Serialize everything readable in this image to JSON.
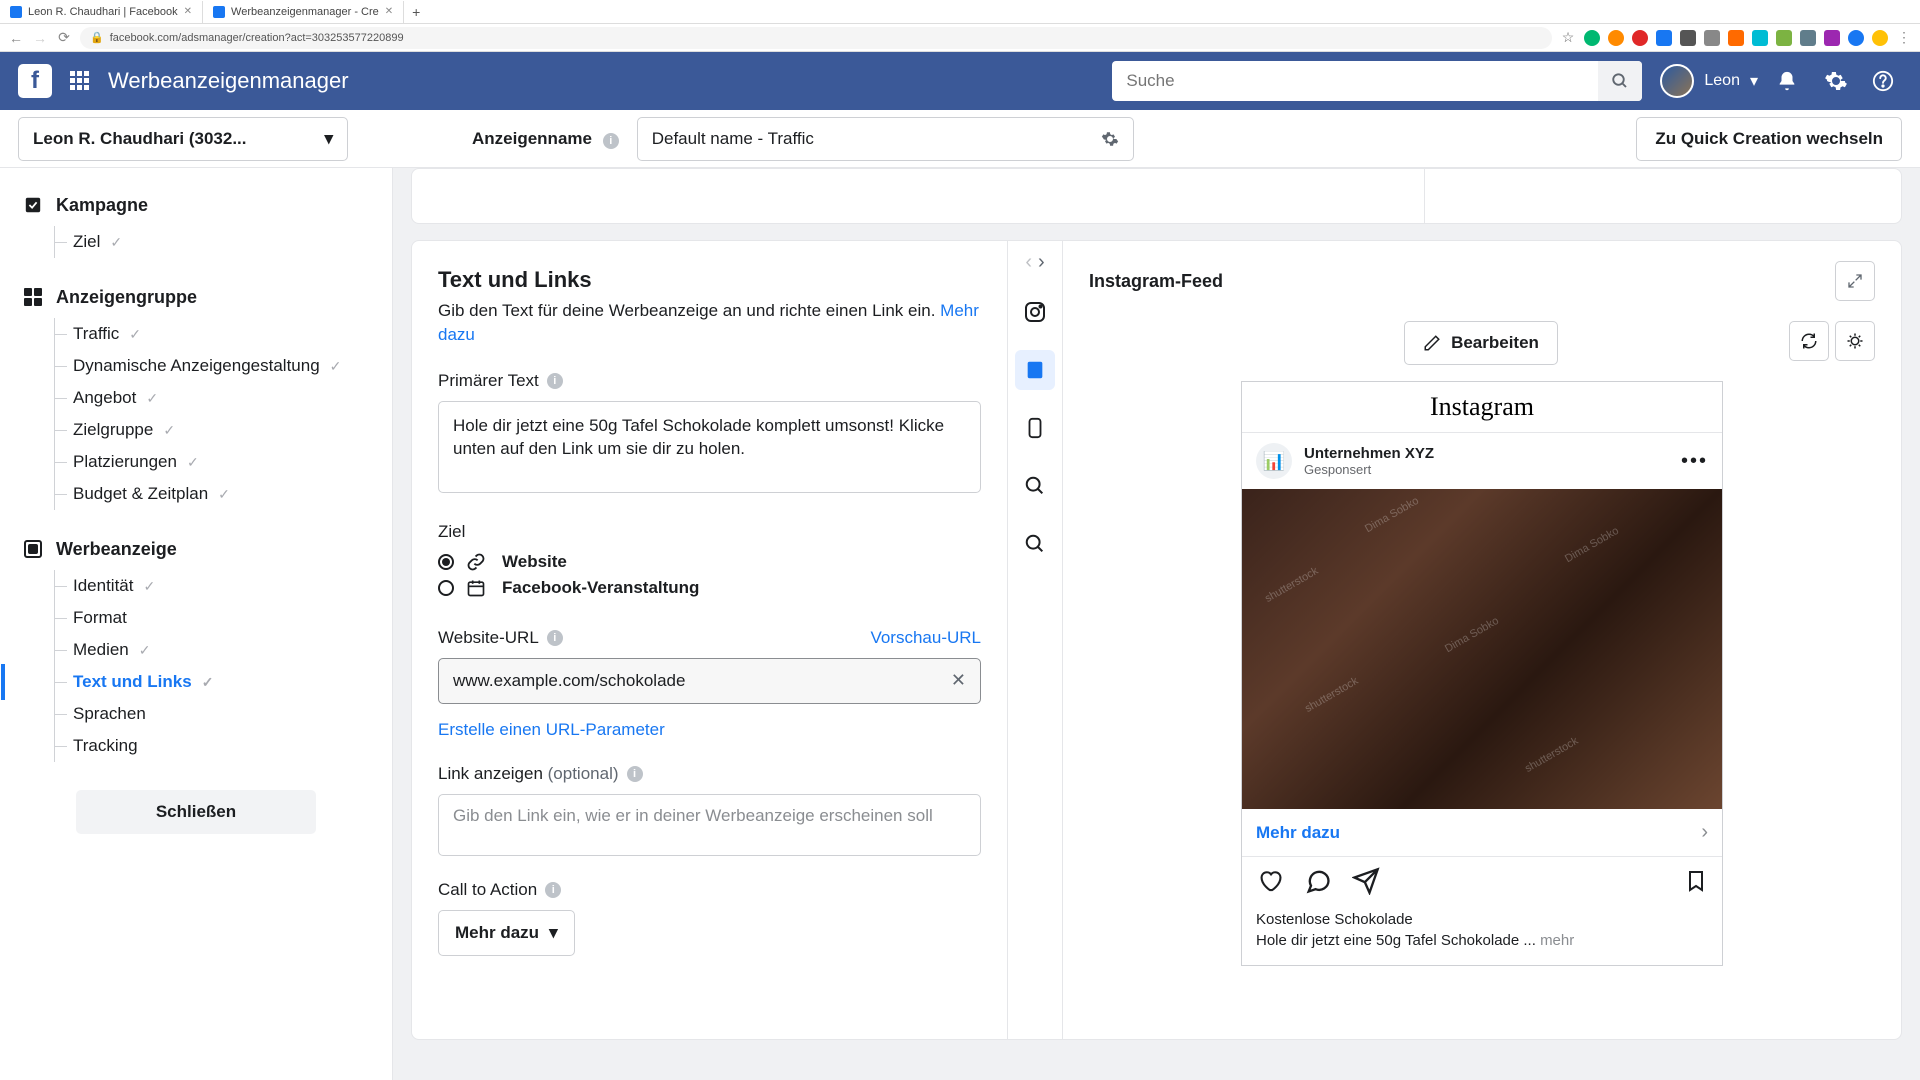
{
  "browser": {
    "tabs": [
      {
        "title": "Leon R. Chaudhari | Facebook",
        "icon_color": "#1877f2"
      },
      {
        "title": "Werbeanzeigenmanager - Cre",
        "icon_color": "#1877f2"
      }
    ],
    "url": "facebook.com/adsmanager/creation?act=303253577220899",
    "ext_colors": [
      "#00b871",
      "#ff8a00",
      "#e02828",
      "#1877f2",
      "#555",
      "#555",
      "#ff6a00",
      "#00bcd4",
      "#4caf50",
      "#607d8b",
      "#9c27b0",
      "#1877f2",
      "#ffc107"
    ]
  },
  "header": {
    "app_title": "Werbeanzeigenmanager",
    "search_placeholder": "Suche",
    "user_name": "Leon"
  },
  "secondbar": {
    "account": "Leon R. Chaudhari (3032...",
    "ad_name_label": "Anzeigenname",
    "ad_name_value": "Default name - Traffic",
    "quick_creation": "Zu Quick Creation wechseln"
  },
  "sidebar": {
    "campaign_label": "Kampagne",
    "campaign_items": [
      {
        "label": "Ziel",
        "checked": true
      }
    ],
    "adset_label": "Anzeigengruppe",
    "adset_items": [
      {
        "label": "Traffic",
        "checked": true
      },
      {
        "label": "Dynamische Anzeigengestaltung",
        "checked": true
      },
      {
        "label": "Angebot",
        "checked": true
      },
      {
        "label": "Zielgruppe",
        "checked": true
      },
      {
        "label": "Platzierungen",
        "checked": true
      },
      {
        "label": "Budget & Zeitplan",
        "checked": true
      }
    ],
    "ad_label": "Werbeanzeige",
    "ad_items": [
      {
        "label": "Identität",
        "checked": true
      },
      {
        "label": "Format",
        "checked": false
      },
      {
        "label": "Medien",
        "checked": true
      },
      {
        "label": "Text und Links",
        "checked": true,
        "active": true
      },
      {
        "label": "Sprachen",
        "checked": false
      },
      {
        "label": "Tracking",
        "checked": false
      }
    ],
    "close": "Schließen"
  },
  "form": {
    "section_title": "Text und Links",
    "section_desc": "Gib den Text für deine Werbeanzeige an und richte einen Link ein. ",
    "more": "Mehr dazu",
    "primary_text_label": "Primärer Text",
    "primary_text_value": "Hole dir jetzt eine 50g Tafel Schokolade komplett umsonst! Klicke unten auf den Link um sie dir zu holen.",
    "destination_label": "Ziel",
    "dest_website": "Website",
    "dest_fb_event": "Facebook-Veranstaltung",
    "website_url_label": "Website-URL",
    "preview_url": "Vorschau-URL",
    "website_url_value": "www.example.com/schokolade",
    "url_param": "Erstelle einen URL-Parameter",
    "display_link_label": "Link anzeigen ",
    "display_link_optional": "(optional)",
    "display_link_placeholder": "Gib den Link ein, wie er in deiner Werbeanzeige erscheinen soll",
    "cta_label": "Call to Action",
    "cta_value": "Mehr dazu"
  },
  "preview": {
    "title": "Instagram-Feed",
    "edit": "Bearbeiten",
    "ig_logo": "Instagram",
    "account_name": "Unternehmen XYZ",
    "sponsored": "Gesponsert",
    "cta": "Mehr dazu",
    "caption_title": "Kostenlose Schokolade",
    "caption_text": "Hole dir jetzt eine 50g Tafel Schokolade ... ",
    "caption_more": "mehr"
  }
}
